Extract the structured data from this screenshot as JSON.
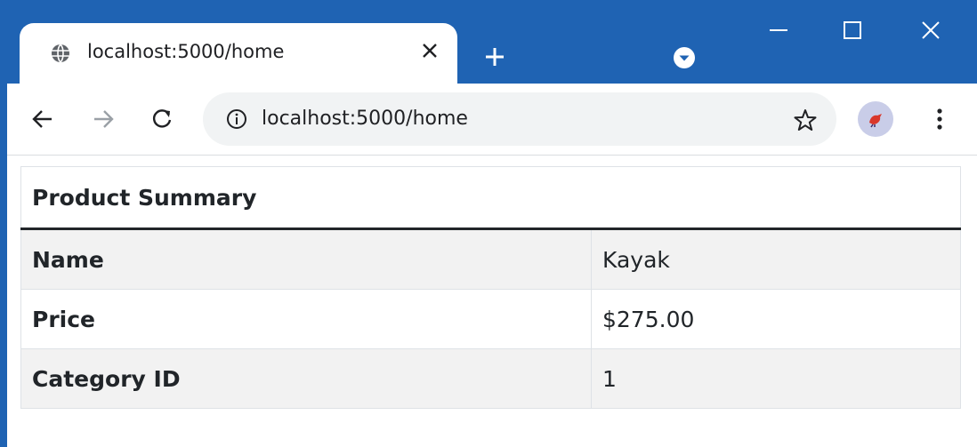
{
  "browser": {
    "tab": {
      "favicon": "globe-icon",
      "title": "localhost:5000/home",
      "close_icon": "close-icon"
    },
    "new_tab_icon": "plus-icon",
    "tab_search_icon": "chevron-down-circle-icon",
    "window_controls": [
      "minimize-icon",
      "maximize-icon",
      "close-icon"
    ],
    "toolbar": {
      "back_icon": "arrow-left-icon",
      "forward_icon": "arrow-right-icon",
      "reload_icon": "reload-icon",
      "info_icon": "info-icon",
      "url": "localhost:5000/home",
      "bookmark_icon": "star-icon",
      "profile_icon": "avatar-bird-icon",
      "menu_icon": "kebab-menu-icon"
    },
    "colors": {
      "frame": "#1f63b3",
      "omnibox": "#f1f3f4",
      "striped_row": "#f2f2f2"
    }
  },
  "page": {
    "table": {
      "heading": "Product Summary",
      "rows": [
        {
          "label": "Name",
          "value": "Kayak"
        },
        {
          "label": "Price",
          "value": "$275.00"
        },
        {
          "label": "Category ID",
          "value": "1"
        }
      ]
    }
  }
}
